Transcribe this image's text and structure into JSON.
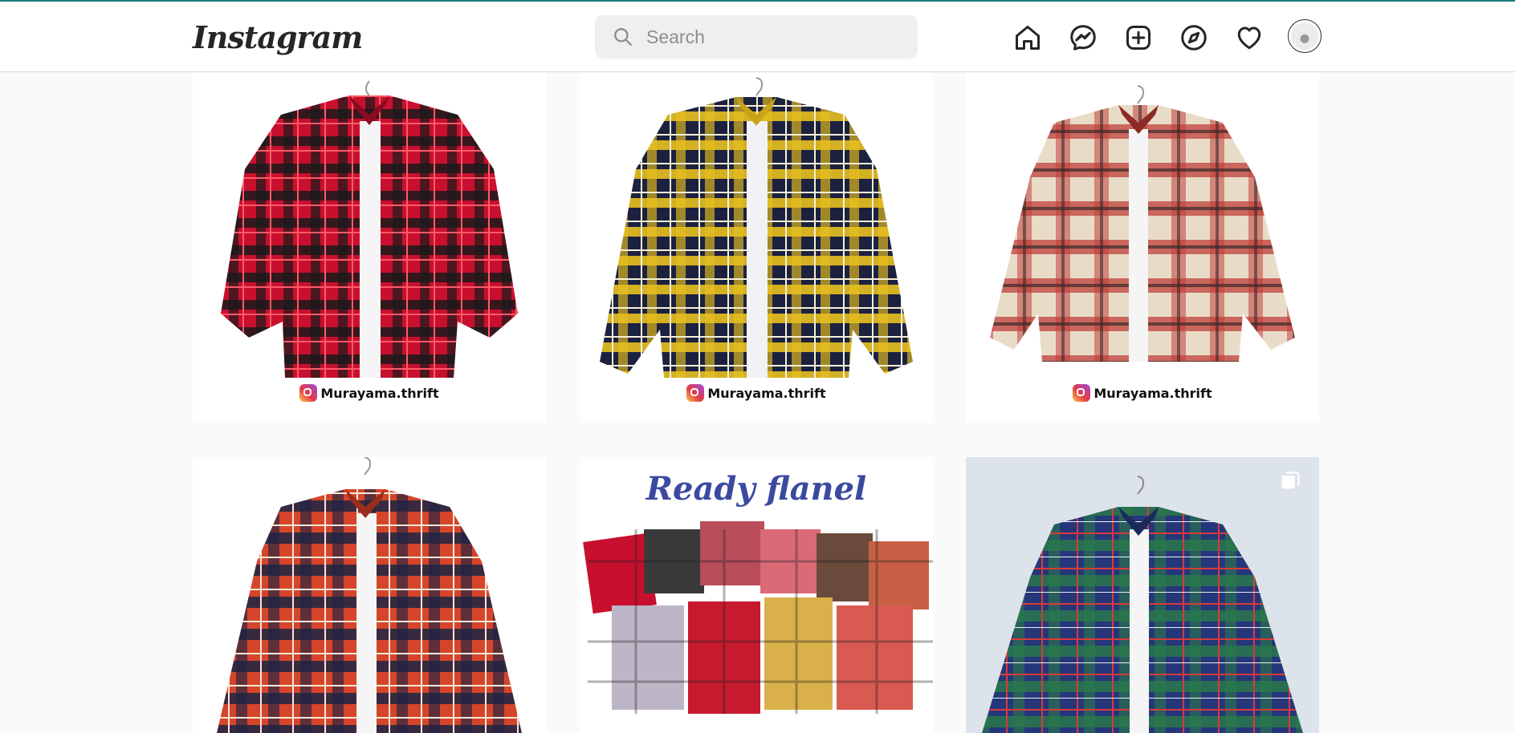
{
  "app": {
    "logo_text": "Instagram"
  },
  "search": {
    "placeholder": "Search",
    "value": ""
  },
  "nav": {
    "icons": [
      "home-icon",
      "messenger-icon",
      "new-post-icon",
      "explore-icon",
      "activity-heart-icon",
      "profile-avatar"
    ]
  },
  "posts": [
    {
      "watermark": "Murayama.thrift",
      "pattern": "red-black plaid shirt",
      "colors": [
        "#c8102e",
        "#1a1a1a"
      ]
    },
    {
      "watermark": "Murayama.thrift",
      "pattern": "yellow-navy plaid shirt",
      "colors": [
        "#e8c020",
        "#1c2140"
      ]
    },
    {
      "watermark": "Murayama.thrift",
      "pattern": "red-cream plaid shirt",
      "colors": [
        "#c0403a",
        "#e8dcc8"
      ]
    },
    {
      "watermark": "",
      "pattern": "orange-navy plaid shirt",
      "colors": [
        "#d6452a",
        "#1d2444"
      ]
    },
    {
      "heading": "Ready flanel",
      "pattern": "assorted folded flannels"
    },
    {
      "watermark": "",
      "pattern": "blue-green plaid shirt",
      "colors": [
        "#25377a",
        "#2a7a4a"
      ],
      "multi": true
    }
  ],
  "colors": {
    "accent": "#1a7a7a",
    "heading_blue": "#3b4aa0"
  }
}
